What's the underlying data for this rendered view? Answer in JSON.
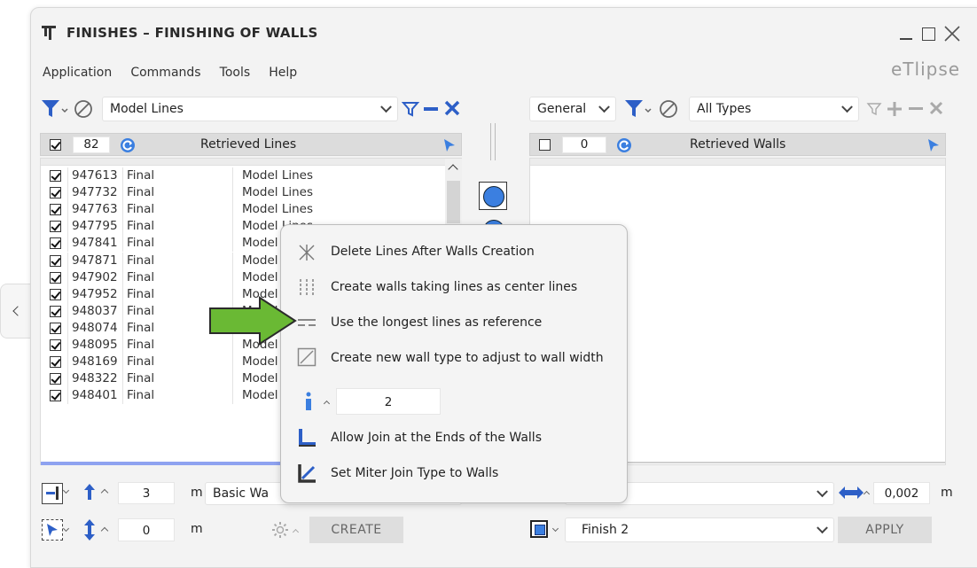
{
  "window": {
    "title": "FINISHES – FINISHING OF WALLS",
    "brand": "eTlipse",
    "controls": {
      "minimize": "—",
      "maximize": "☐",
      "close": "✕"
    }
  },
  "menu": [
    "Application",
    "Commands",
    "Tools",
    "Help"
  ],
  "left": {
    "category_value": "Model Lines",
    "header": {
      "count": "82",
      "title": "Retrieved Lines"
    },
    "rows": [
      {
        "id": "947613",
        "phase": "Final",
        "type": "Model Lines"
      },
      {
        "id": "947732",
        "phase": "Final",
        "type": "Model Lines"
      },
      {
        "id": "947763",
        "phase": "Final",
        "type": "Model Lines"
      },
      {
        "id": "947795",
        "phase": "Final",
        "type": "Model Lines"
      },
      {
        "id": "947841",
        "phase": "Final",
        "type": "Model Lines"
      },
      {
        "id": "947871",
        "phase": "Final",
        "type": "Model Lines"
      },
      {
        "id": "947902",
        "phase": "Final",
        "type": "Model Lines"
      },
      {
        "id": "947952",
        "phase": "Final",
        "type": "Model Lines"
      },
      {
        "id": "948037",
        "phase": "Final",
        "type": "Model Lines"
      },
      {
        "id": "948074",
        "phase": "Final",
        "type": "Model Lines"
      },
      {
        "id": "948095",
        "phase": "Final",
        "type": "Model Lines"
      },
      {
        "id": "948169",
        "phase": "Final",
        "type": "Model Lines"
      },
      {
        "id": "948322",
        "phase": "Final",
        "type": "Model Lines"
      },
      {
        "id": "948401",
        "phase": "Final",
        "type": "Model Lines"
      }
    ],
    "bottom": {
      "height_value": "3",
      "height_unit": "m",
      "offset_value": "0",
      "offset_unit": "m",
      "wall_type_value": "Basic Wa",
      "create_label": "CREATE"
    }
  },
  "right": {
    "general_value": "General",
    "types_value": "All Types",
    "header": {
      "count": "0",
      "title": "Retrieved Walls"
    },
    "bottom": {
      "thickness_value": "0,002",
      "thickness_unit": "m",
      "finish_value": "Finish 2",
      "apply_label": "APPLY"
    }
  },
  "popup": {
    "items": [
      "Delete Lines After Walls Creation",
      "Create walls taking lines as center lines",
      "Use the longest lines as reference",
      "Create new wall type to adjust to wall width"
    ],
    "stepper_value": "2",
    "items2": [
      "Allow Join at the Ends of the Walls",
      "Set Miter Join Type to Walls"
    ]
  },
  "colors": {
    "accent_blue": "#3b7fe0",
    "filter_blue": "#2d5fc7",
    "arrow_green": "#6ab934",
    "selection_bar": "#8ea2f0"
  }
}
